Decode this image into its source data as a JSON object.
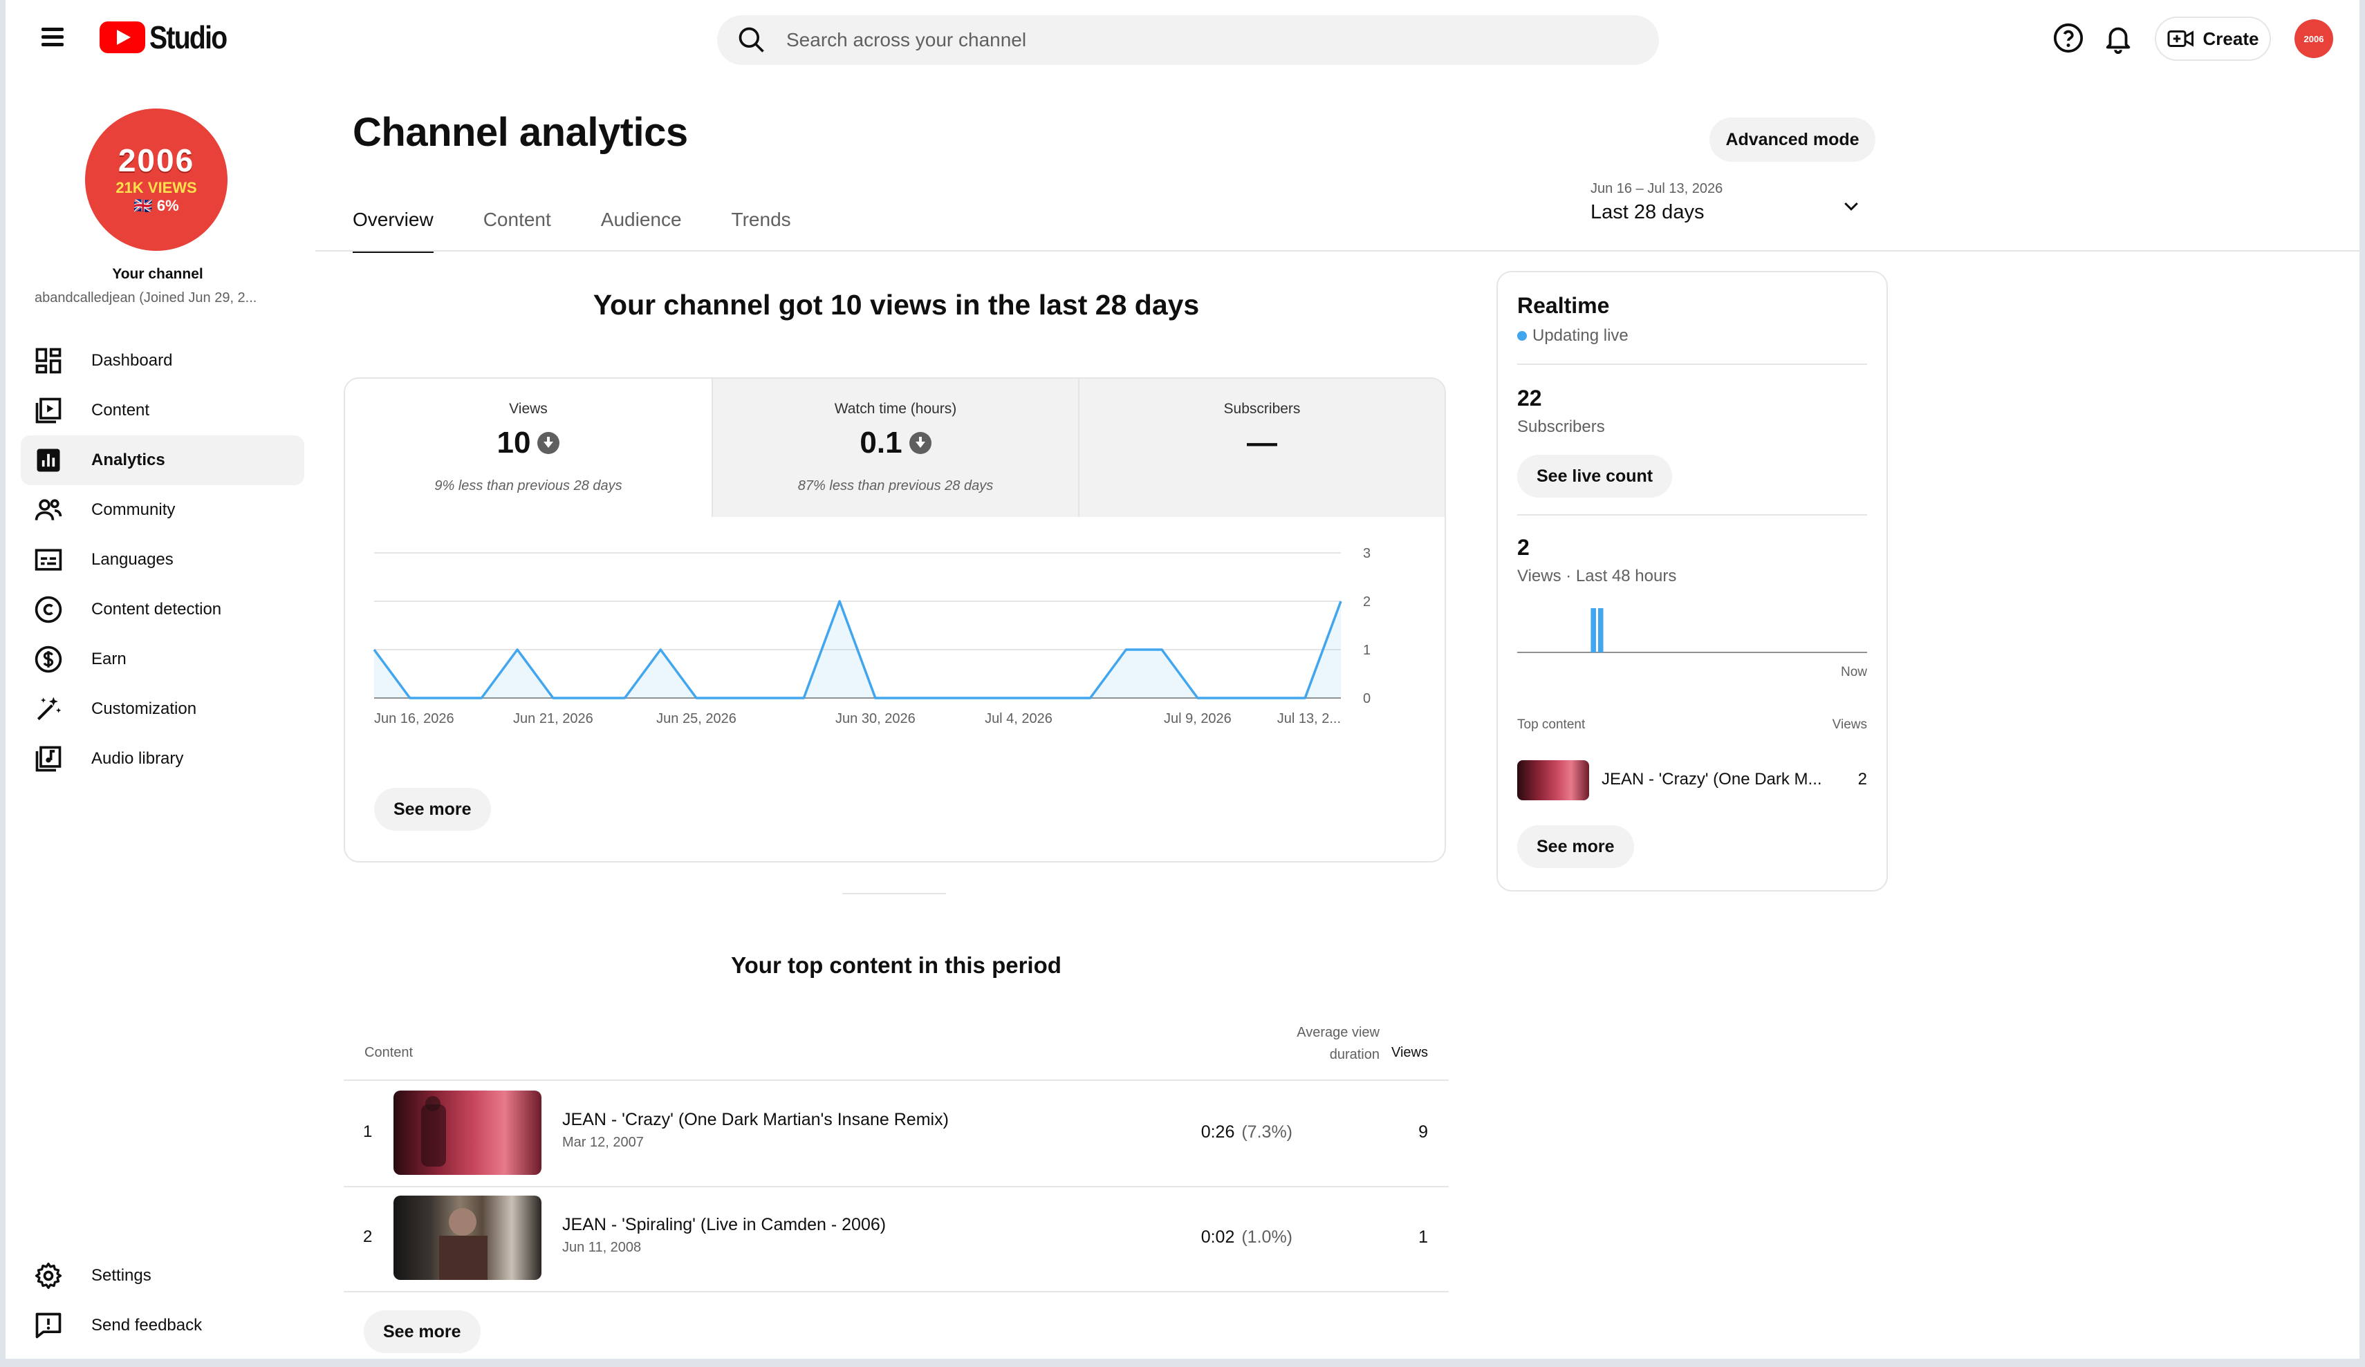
{
  "app": {
    "logo_text": "Studio"
  },
  "search": {
    "placeholder": "Search across your channel"
  },
  "topbar": {
    "create_label": "Create",
    "avatar_text": "2006"
  },
  "sidebar": {
    "avatar": {
      "line1": "2006",
      "line2": "21K VIEWS",
      "line3": "🇬🇧 6%"
    },
    "your_channel": "Your channel",
    "handle": "abandcalledjean (Joined Jun 29, 2...",
    "items": [
      {
        "label": "Dashboard",
        "icon": "dashboard-icon"
      },
      {
        "label": "Content",
        "icon": "content-icon"
      },
      {
        "label": "Analytics",
        "icon": "analytics-icon",
        "active": true
      },
      {
        "label": "Community",
        "icon": "community-icon"
      },
      {
        "label": "Languages",
        "icon": "languages-icon"
      },
      {
        "label": "Content detection",
        "icon": "copyright-icon"
      },
      {
        "label": "Earn",
        "icon": "earn-icon"
      },
      {
        "label": "Customization",
        "icon": "customization-icon"
      },
      {
        "label": "Audio library",
        "icon": "audio-library-icon"
      }
    ],
    "bottom_items": [
      {
        "label": "Settings",
        "icon": "gear-icon"
      },
      {
        "label": "Send feedback",
        "icon": "feedback-icon"
      }
    ]
  },
  "main": {
    "title": "Channel analytics",
    "advanced_mode": "Advanced mode",
    "tabs": [
      "Overview",
      "Content",
      "Audience",
      "Trends"
    ],
    "active_tab": "Overview",
    "date_range": {
      "dates": "Jun 16 – Jul 13, 2026",
      "label": "Last 28 days"
    },
    "headline": "Your channel got 10 views in the last 28 days",
    "metrics": [
      {
        "label": "Views",
        "value": "10",
        "trend": "down",
        "comparison": "9% less than previous 28 days"
      },
      {
        "label": "Watch time (hours)",
        "value": "0.1",
        "trend": "down",
        "comparison": "87% less than previous 28 days"
      },
      {
        "label": "Subscribers",
        "value": "—",
        "trend": "",
        "comparison": ""
      }
    ],
    "see_more": "See more",
    "top_content": {
      "title": "Your top content in this period",
      "headers": {
        "content": "Content",
        "avd_line1": "Average view",
        "avd_line2": "duration",
        "views": "Views"
      },
      "rows": [
        {
          "rank": "1",
          "title": "JEAN - 'Crazy' (One Dark Martian's Insane Remix)",
          "date": "Mar 12, 2007",
          "avd": "0:26",
          "avd_pct": "(7.3%)",
          "views": "9"
        },
        {
          "rank": "2",
          "title": "JEAN - 'Spiraling' (Live in Camden - 2006)",
          "date": "Jun 11, 2008",
          "avd": "0:02",
          "avd_pct": "(1.0%)",
          "views": "1"
        }
      ],
      "see_more": "See more"
    }
  },
  "realtime": {
    "title": "Realtime",
    "status": "Updating live",
    "subscribers": {
      "value": "22",
      "label": "Subscribers",
      "button": "See live count"
    },
    "views": {
      "value": "2",
      "label": "Views · Last 48 hours",
      "now_label": "Now"
    },
    "top_content_label": "Top content",
    "views_col": "Views",
    "top_item": {
      "title": "JEAN - 'Crazy' (One Dark M...",
      "views": "2"
    },
    "see_more": "See more"
  },
  "chart_data": {
    "type": "area",
    "x_ticks": [
      "Jun 16, 2026",
      "Jun 21, 2026",
      "Jun 25, 2026",
      "Jun 30, 2026",
      "Jul 4, 2026",
      "Jul 9, 2026",
      "Jul 13, 2..."
    ],
    "x_start": "2026-06-16",
    "x_end": "2026-07-13",
    "series": [
      {
        "values": [
          1,
          0,
          0,
          0,
          1,
          0,
          0,
          0,
          1,
          0,
          0,
          0,
          0,
          2,
          0,
          0,
          0,
          0,
          0,
          0,
          0,
          1,
          1,
          0,
          0,
          0,
          0,
          2
        ]
      }
    ],
    "y_ticks": [
      "0",
      "1",
      "2",
      "3"
    ],
    "ylim": [
      0,
      3
    ],
    "color": "#41a6ee",
    "grid": true,
    "realtime_bars": [
      0,
      0,
      0,
      0,
      0,
      0,
      0,
      0,
      0,
      0,
      1,
      1,
      0,
      0,
      0,
      0,
      0,
      0,
      0,
      0,
      0,
      0,
      0,
      0,
      0,
      0,
      0,
      0,
      0,
      0,
      0,
      0,
      0,
      0,
      0,
      0,
      0,
      0,
      0,
      0,
      0,
      0,
      0,
      0,
      0,
      0,
      0,
      0
    ]
  }
}
